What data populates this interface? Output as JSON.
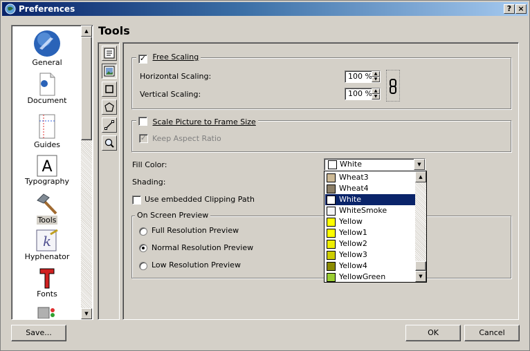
{
  "window": {
    "title": "Preferences",
    "help_label": "?",
    "close_label": "×"
  },
  "page": {
    "title": "Tools"
  },
  "categories": [
    {
      "label": "General",
      "icon": "globe-icon"
    },
    {
      "label": "Document",
      "icon": "document-icon"
    },
    {
      "label": "Guides",
      "icon": "guides-icon"
    },
    {
      "label": "Typography",
      "icon": "typography-icon"
    },
    {
      "label": "Tools",
      "icon": "hammer-icon",
      "selected": true
    },
    {
      "label": "Hyphenator",
      "icon": "hyphenator-icon"
    },
    {
      "label": "Fonts",
      "icon": "fonts-icon"
    }
  ],
  "tool_tabs": [
    "text-frame-icon",
    "image-frame-icon",
    "shape-icon",
    "polygon-icon",
    "line-icon",
    "zoom-icon"
  ],
  "free_scaling": {
    "label": "Free Scaling",
    "checked": true,
    "horizontal_label": "Horizontal Scaling:",
    "horizontal_value": "100 %",
    "vertical_label": "Vertical Scaling:",
    "vertical_value": "100 %"
  },
  "scale_to_frame": {
    "label": "Scale Picture to Frame Size",
    "checked": false
  },
  "keep_aspect": {
    "label": "Keep Aspect Ratio",
    "checked": true,
    "disabled": true
  },
  "fill_color": {
    "label": "Fill Color:",
    "value": "White",
    "swatch": "#ffffff"
  },
  "shading": {
    "label": "Shading:"
  },
  "clipping": {
    "label": "Use embedded Clipping Path",
    "checked": false
  },
  "preview": {
    "legend": "On Screen Preview",
    "options": [
      "Full Resolution Preview",
      "Normal Resolution Preview",
      "Low Resolution Preview"
    ],
    "selected": "Normal Resolution Preview"
  },
  "color_options": [
    {
      "name": "Wheat3",
      "color": "#cdba96"
    },
    {
      "name": "Wheat4",
      "color": "#8b7e66"
    },
    {
      "name": "White",
      "color": "#ffffff",
      "selected": true
    },
    {
      "name": "WhiteSmoke",
      "color": "#f5f5f5"
    },
    {
      "name": "Yellow",
      "color": "#ffff00"
    },
    {
      "name": "Yellow1",
      "color": "#ffff00"
    },
    {
      "name": "Yellow2",
      "color": "#eeee00"
    },
    {
      "name": "Yellow3",
      "color": "#cdcd00"
    },
    {
      "name": "Yellow4",
      "color": "#8b8b00"
    },
    {
      "name": "YellowGreen",
      "color": "#9acd32"
    }
  ],
  "buttons": {
    "save": "Save...",
    "ok": "OK",
    "cancel": "Cancel"
  }
}
